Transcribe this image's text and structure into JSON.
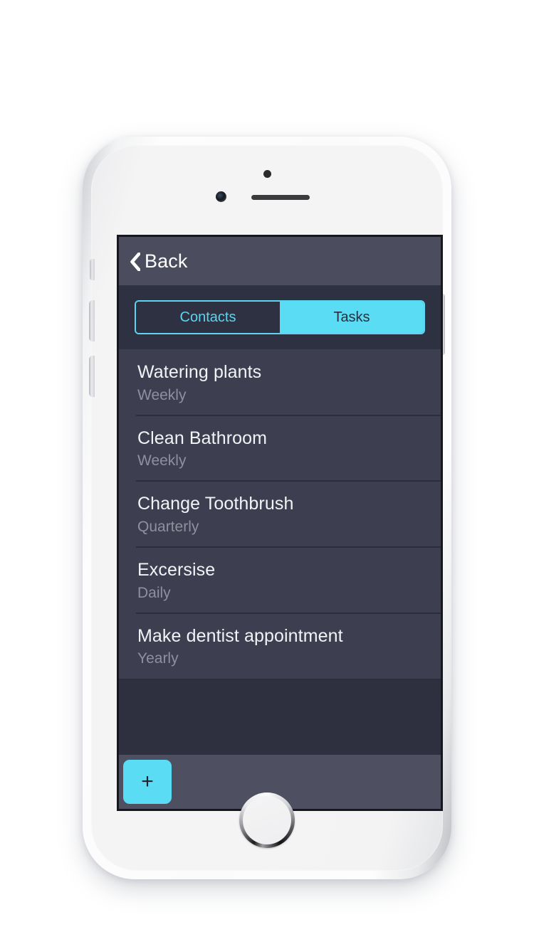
{
  "app": {
    "background_color": "#ffffff",
    "accent_color": "#5bdcf5",
    "screen_background": "#2e3040",
    "navbar_color": "#4b4d5e",
    "row_color": "#3d3f50",
    "toolbar_color": "#4e5062"
  },
  "navbar": {
    "back_label": "Back",
    "back_icon": "chevron-left-icon"
  },
  "segment": {
    "options": [
      {
        "label": "Contacts",
        "selected": false
      },
      {
        "label": "Tasks",
        "selected": true
      }
    ],
    "selected_label": "Tasks"
  },
  "tasks": [
    {
      "title": "Watering plants",
      "frequency": "Weekly"
    },
    {
      "title": "Clean Bathroom",
      "frequency": "Weekly"
    },
    {
      "title": "Change Toothbrush",
      "frequency": "Quarterly"
    },
    {
      "title": "Excersise",
      "frequency": "Daily"
    },
    {
      "title": "Make dentist appointment",
      "frequency": "Yearly"
    }
  ],
  "toolbar": {
    "add_label": "+",
    "add_icon": "plus-icon"
  },
  "device": {
    "type": "smartphone",
    "home_button": "home-button",
    "front_camera": "camera-icon",
    "proximity_sensor": "sensor-icon",
    "earpiece": "speaker-grille"
  }
}
